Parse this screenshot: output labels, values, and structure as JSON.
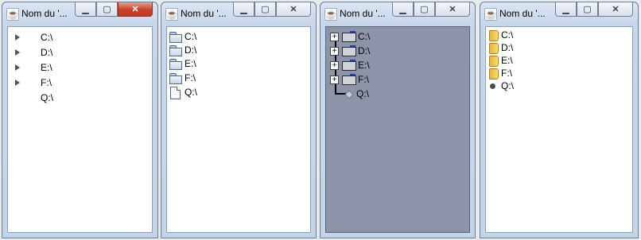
{
  "windows": [
    {
      "title": "Nom du '...",
      "controls": {
        "minimize": "▁",
        "maximize": "▢",
        "close": "✕"
      },
      "tree": [
        {
          "label": "C:\\",
          "icon": "collapsed-arrow-icon"
        },
        {
          "label": "D:\\",
          "icon": "collapsed-arrow-icon"
        },
        {
          "label": "E:\\",
          "icon": "collapsed-arrow-icon"
        },
        {
          "label": "F:\\",
          "icon": "collapsed-arrow-icon"
        },
        {
          "label": "Q:\\",
          "icon": "none"
        }
      ]
    },
    {
      "title": "Nom du '...",
      "controls": {
        "minimize": "▁",
        "maximize": "▢",
        "close": "✕"
      },
      "tree": [
        {
          "label": "C:\\",
          "icon": "folder-icon"
        },
        {
          "label": "D:\\",
          "icon": "folder-icon"
        },
        {
          "label": "E:\\",
          "icon": "folder-icon"
        },
        {
          "label": "F:\\",
          "icon": "folder-icon"
        },
        {
          "label": "Q:\\",
          "icon": "file-icon"
        }
      ]
    },
    {
      "title": "Nom du '...",
      "controls": {
        "minimize": "▁",
        "maximize": "▢",
        "close": "✕"
      },
      "tree": [
        {
          "label": "C:\\",
          "icon": "folder-icon"
        },
        {
          "label": "D:\\",
          "icon": "folder-icon"
        },
        {
          "label": "E:\\",
          "icon": "folder-icon"
        },
        {
          "label": "F:\\",
          "icon": "folder-icon"
        },
        {
          "label": "Q:\\",
          "icon": "leaf-icon"
        }
      ]
    },
    {
      "title": "Nom du '...",
      "controls": {
        "minimize": "▁",
        "maximize": "▢",
        "close": "✕"
      },
      "tree": [
        {
          "label": "C:\\",
          "icon": "folder-icon"
        },
        {
          "label": "D:\\",
          "icon": "folder-icon"
        },
        {
          "label": "E:\\",
          "icon": "folder-icon"
        },
        {
          "label": "F:\\",
          "icon": "folder-icon"
        },
        {
          "label": "Q:\\",
          "icon": "leaf-dot-icon"
        }
      ]
    }
  ],
  "colors": {
    "titlebar": "#c7d6ea",
    "close_active": "#c7412a",
    "tree_gray_background": "#8e94a8"
  }
}
